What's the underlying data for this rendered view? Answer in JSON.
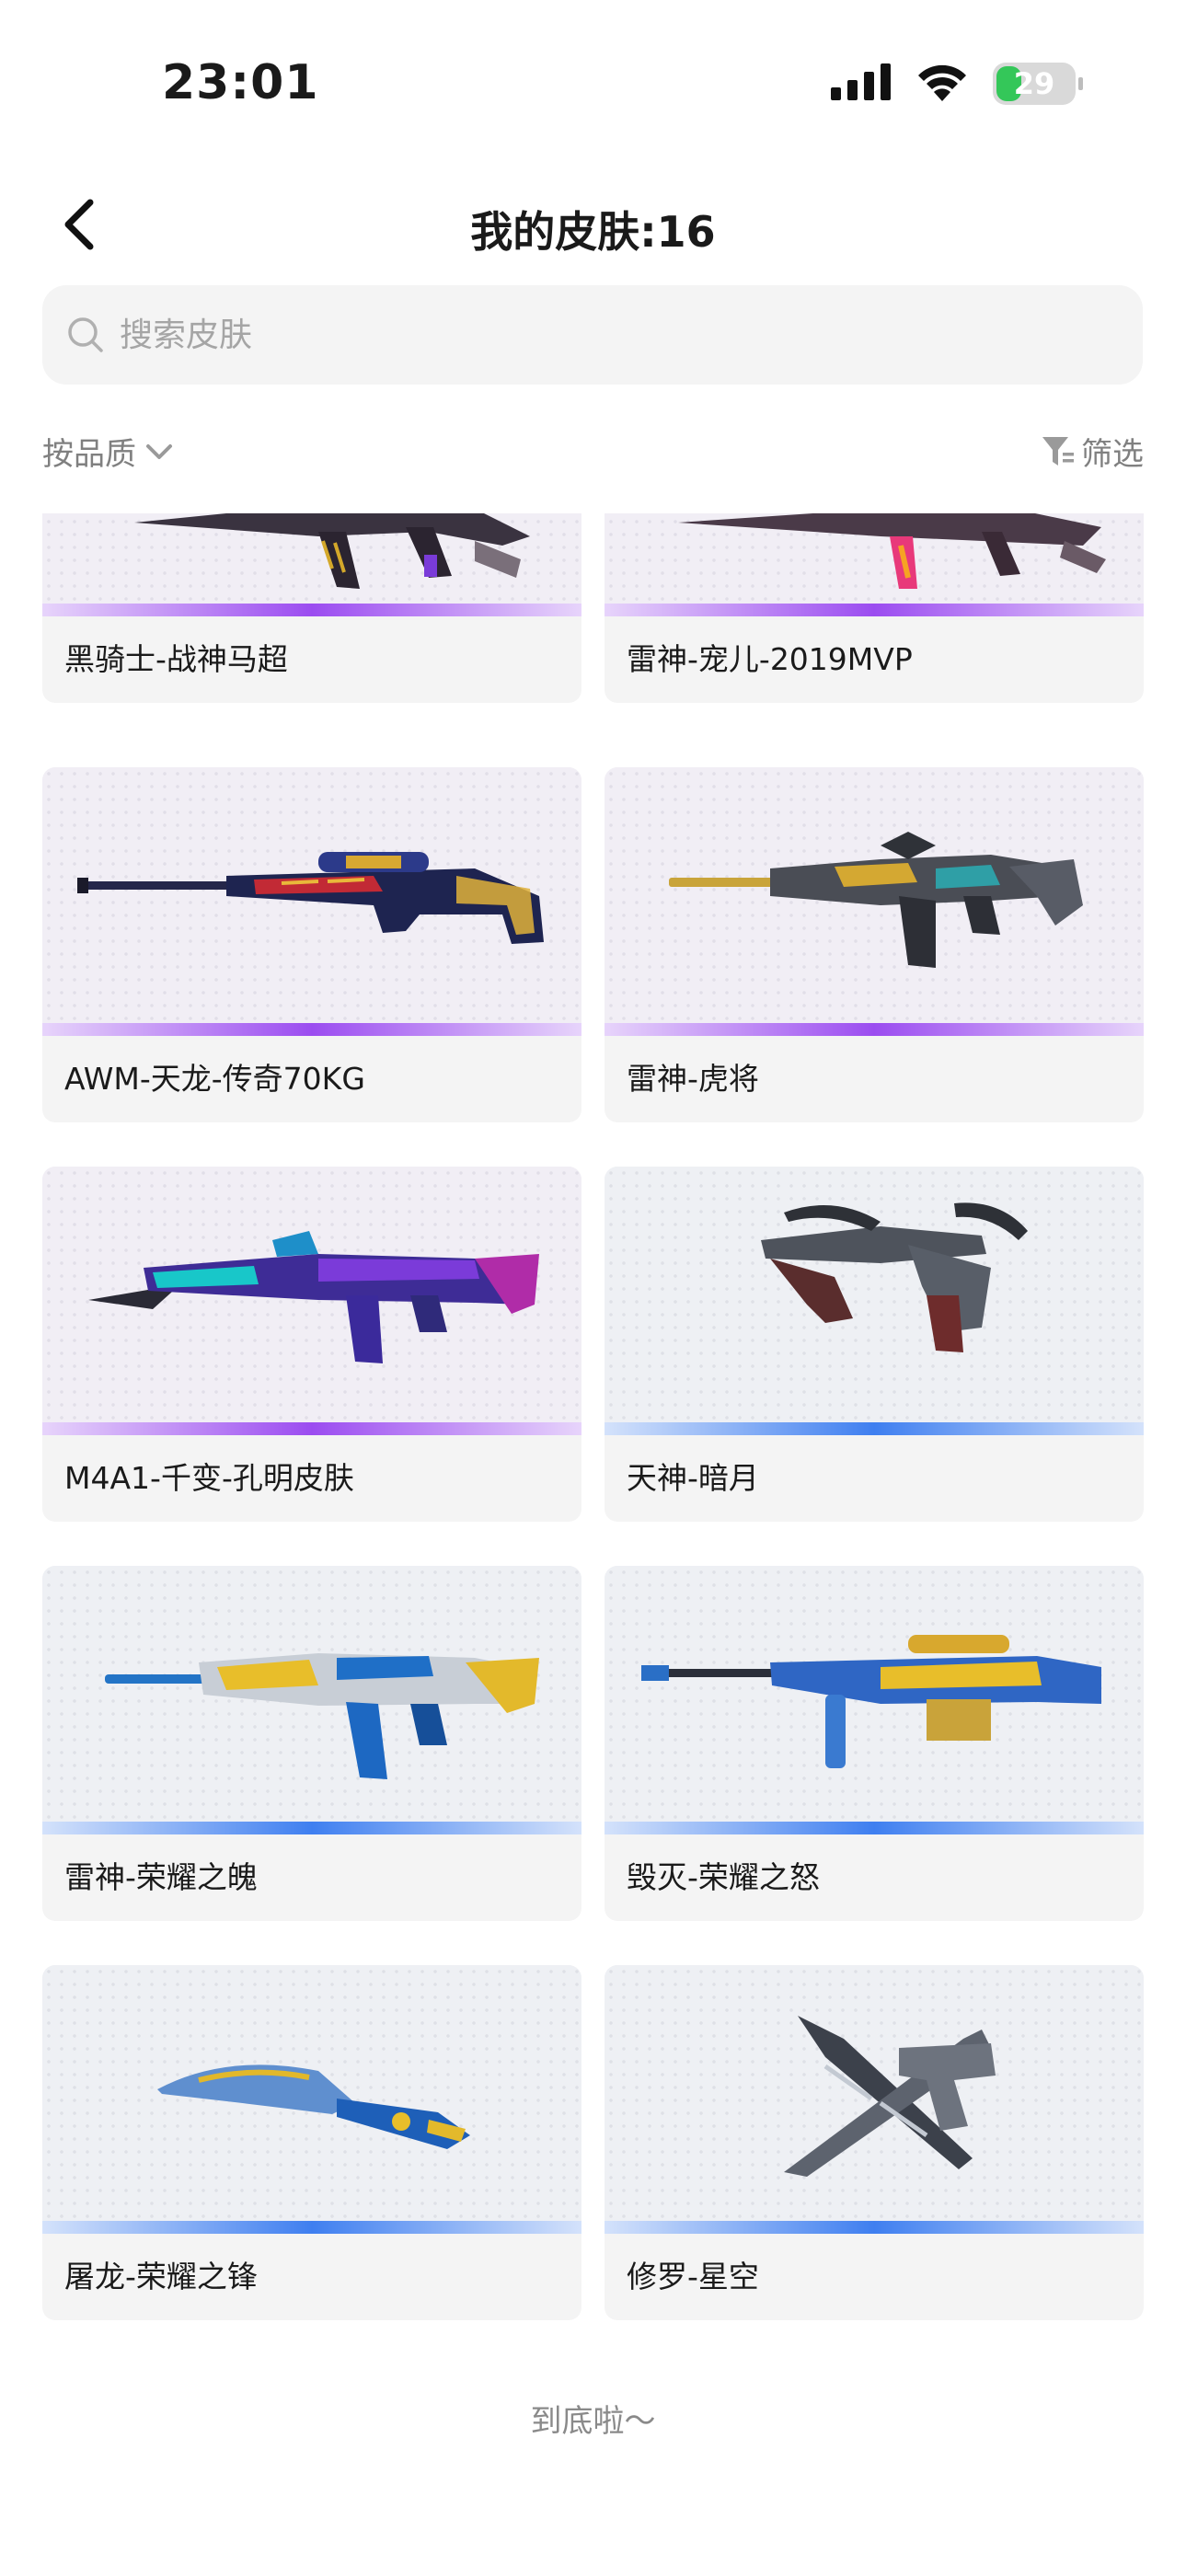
{
  "status": {
    "time": "23:01",
    "battery": "29"
  },
  "nav": {
    "title": "我的皮肤:16"
  },
  "search": {
    "placeholder": "搜索皮肤"
  },
  "filters": {
    "sort_label": "按品质",
    "filter_label": "筛选"
  },
  "colors": {
    "purple_quality": "#9b4cf0",
    "blue_quality": "#3f7ff0"
  },
  "skins": [
    {
      "name": "黑骑士-战神马超",
      "quality": "purple"
    },
    {
      "name": "雷神-宠儿-2019MVP",
      "quality": "purple"
    },
    {
      "name": "AWM-天龙-传奇70KG",
      "quality": "purple"
    },
    {
      "name": "雷神-虎将",
      "quality": "purple"
    },
    {
      "name": "M4A1-千变-孔明皮肤",
      "quality": "purple"
    },
    {
      "name": "天神-暗月",
      "quality": "blue"
    },
    {
      "name": "雷神-荣耀之魄",
      "quality": "blue"
    },
    {
      "name": "毁灭-荣耀之怒",
      "quality": "blue"
    },
    {
      "name": "屠龙-荣耀之锋",
      "quality": "blue"
    },
    {
      "name": "修罗-星空",
      "quality": "blue"
    }
  ],
  "footer": {
    "end_text": "到底啦～"
  }
}
